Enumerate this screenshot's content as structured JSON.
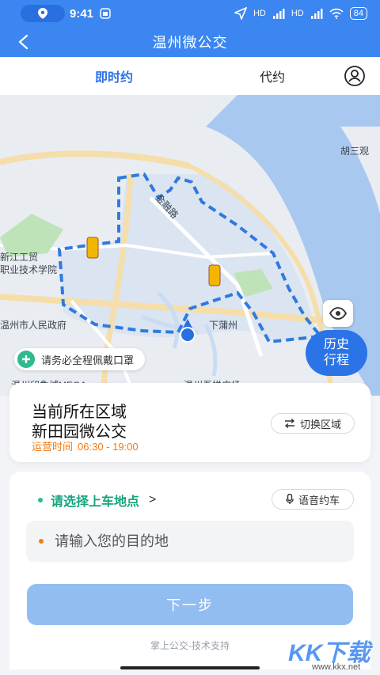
{
  "status_bar": {
    "time": "9:41",
    "signal_1": "HD",
    "signal_2": "HD",
    "battery": "84"
  },
  "header": {
    "title": "温州微公交"
  },
  "tabs": [
    {
      "label": "即时约",
      "active": true
    },
    {
      "label": "代约",
      "active": false
    }
  ],
  "map": {
    "labels": [
      "胡三观",
      "金融路",
      "新江工贸",
      "职业技术学院",
      "温州市人民政府",
      "下蒲州",
      "温州印象城MEGA",
      "温州吾悦广场"
    ],
    "locate_icon": "eye-target-icon",
    "history_button": {
      "line1": "历史",
      "line2": "行程"
    },
    "mask_notice": "请务必全程佩戴口罩"
  },
  "area": {
    "title": "当前所在区域",
    "name": "新田园微公交",
    "hours_label": "运营时间",
    "hours_value": "06:30 - 19:00",
    "switch_label": "切换区域"
  },
  "trip": {
    "pickup_label": "请选择上车地点",
    "pickup_arrow": ">",
    "voice_label": "语音约车",
    "destination_placeholder": "请输入您的目的地",
    "next_label": "下一步",
    "tech_support": "掌上公交-技术支持"
  },
  "watermark": {
    "main": "KK下载",
    "sub": "www.kkx.net"
  },
  "colors": {
    "primary": "#3b86f0",
    "accent_green": "#16a37f",
    "accent_orange": "#ef7b18",
    "button_disabled": "#92bdf1"
  }
}
